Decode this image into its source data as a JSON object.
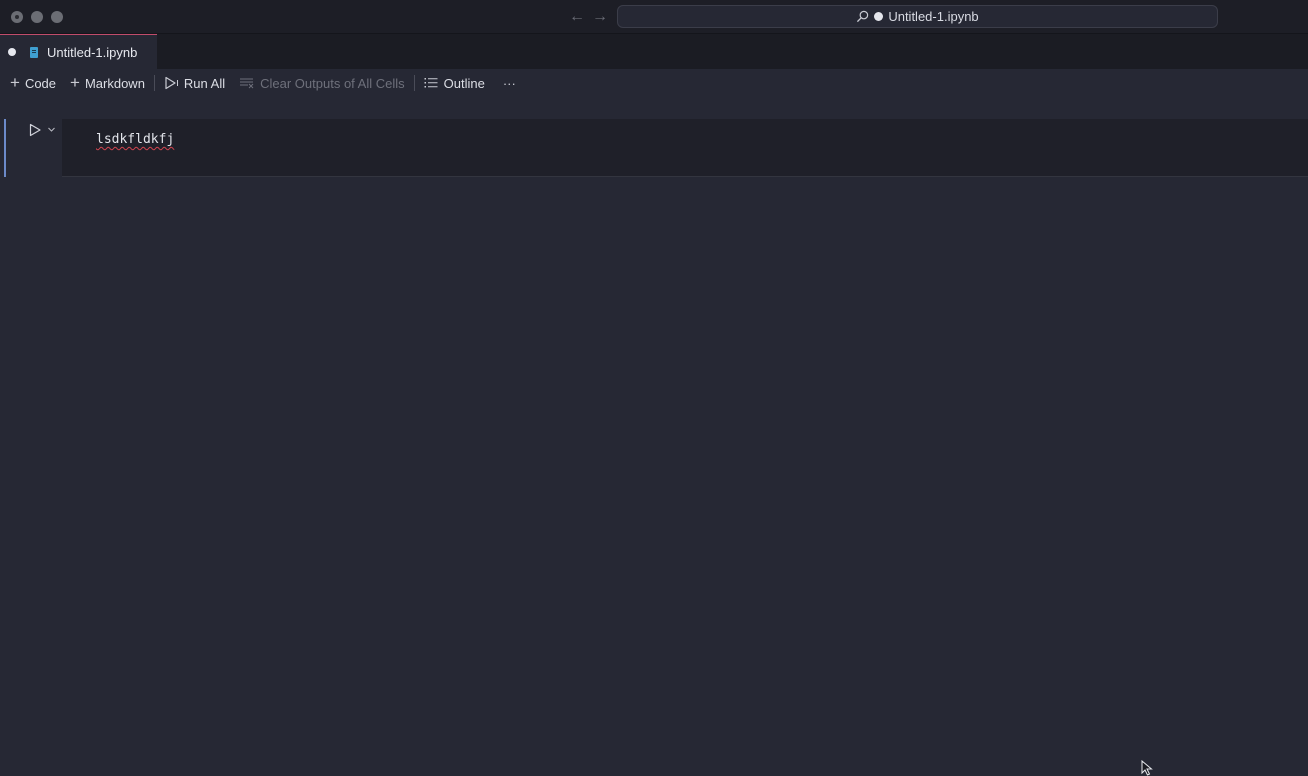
{
  "window": {
    "title": "Untitled-1.ipynb",
    "icons": {
      "close": "close-traffic-light",
      "minimize": "minimize-traffic-light",
      "maximize": "maximize-traffic-light",
      "back": "arrow-left-icon",
      "forward": "arrow-right-icon",
      "search": "search-icon"
    }
  },
  "tab": {
    "label": "Untitled-1.ipynb",
    "accent_color": "#c14c6b",
    "icon": "notebook-icon"
  },
  "toolbar": {
    "code_label": "Code",
    "markdown_label": "Markdown",
    "run_all_label": "Run All",
    "clear_outputs_label": "Clear Outputs of All Cells",
    "outline_label": "Outline",
    "more_label": "···"
  },
  "cell": {
    "source": "lsdkfldkfj",
    "focus_color": "#6c8ac9",
    "error_underline_color": "#d2444f"
  }
}
